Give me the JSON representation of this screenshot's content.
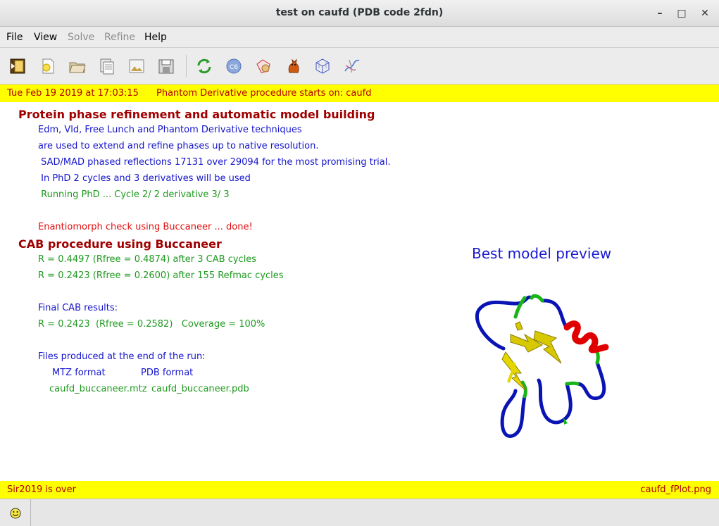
{
  "window": {
    "title": "test on caufd (PDB code 2fdn)",
    "controls": {
      "minimize": "–",
      "maximize": "□",
      "close": "✕"
    }
  },
  "menu": {
    "items": [
      {
        "label": "File",
        "enabled": true
      },
      {
        "label": "View",
        "enabled": true
      },
      {
        "label": "Solve",
        "enabled": false
      },
      {
        "label": "Refine",
        "enabled": false
      },
      {
        "label": "Help",
        "enabled": true
      }
    ]
  },
  "toolbar": {
    "icons": [
      "exit-icon",
      "new-icon",
      "open-folder-icon",
      "document-icon",
      "image-icon",
      "save-icon",
      "refresh-icon",
      "sequence-icon",
      "structure-icon",
      "cat-icon",
      "cell-icon",
      "model-icon"
    ]
  },
  "top_status": {
    "date": "Tue Feb 19  2019 at 17:03:15",
    "message": "Phantom Derivative procedure starts on: caufd"
  },
  "log": {
    "heading1": "Protein phase refinement and automatic model building",
    "line1": "Edm, Vld, Free Lunch and Phantom Derivative techniques",
    "line2": "are used to extend and refine phases up to native resolution.",
    "line3": " SAD/MAD phased reflections 17131 over 29094 for the most promising trial.",
    "line4": " In PhD 2 cycles and 3 derivatives will be used",
    "line5": " Running PhD ... Cycle 2/ 2 derivative 3/ 3",
    "line6": "Enantiomorph check using Buccaneer ... done!",
    "heading2": "CAB procedure using Buccaneer",
    "line7": "R = 0.4497 (Rfree = 0.4874) after 3 CAB cycles",
    "line8": "R = 0.2423 (Rfree = 0.2600) after 155 Refmac cycles",
    "line9": "Final CAB results:",
    "line10": "R = 0.2423  (Rfree = 0.2582)   Coverage = 100%",
    "line11": "Files produced at the end of the run:",
    "mtz_label": "MTZ format",
    "pdb_label": "PDB format",
    "mtz_file": "caufd_buccaneer.mtz",
    "pdb_file": "caufd_buccaneer.pdb"
  },
  "preview": {
    "title": "Best model preview"
  },
  "bottom_status": {
    "left": "Sir2019 is over",
    "right": "caufd_fPlot.png"
  },
  "colors": {
    "status_bg": "#ffff00",
    "status_text": "#b30000",
    "heading": "#a00000",
    "blue_text": "#1515cc",
    "green_text": "#1f9a1f",
    "red_text": "#e01010"
  }
}
